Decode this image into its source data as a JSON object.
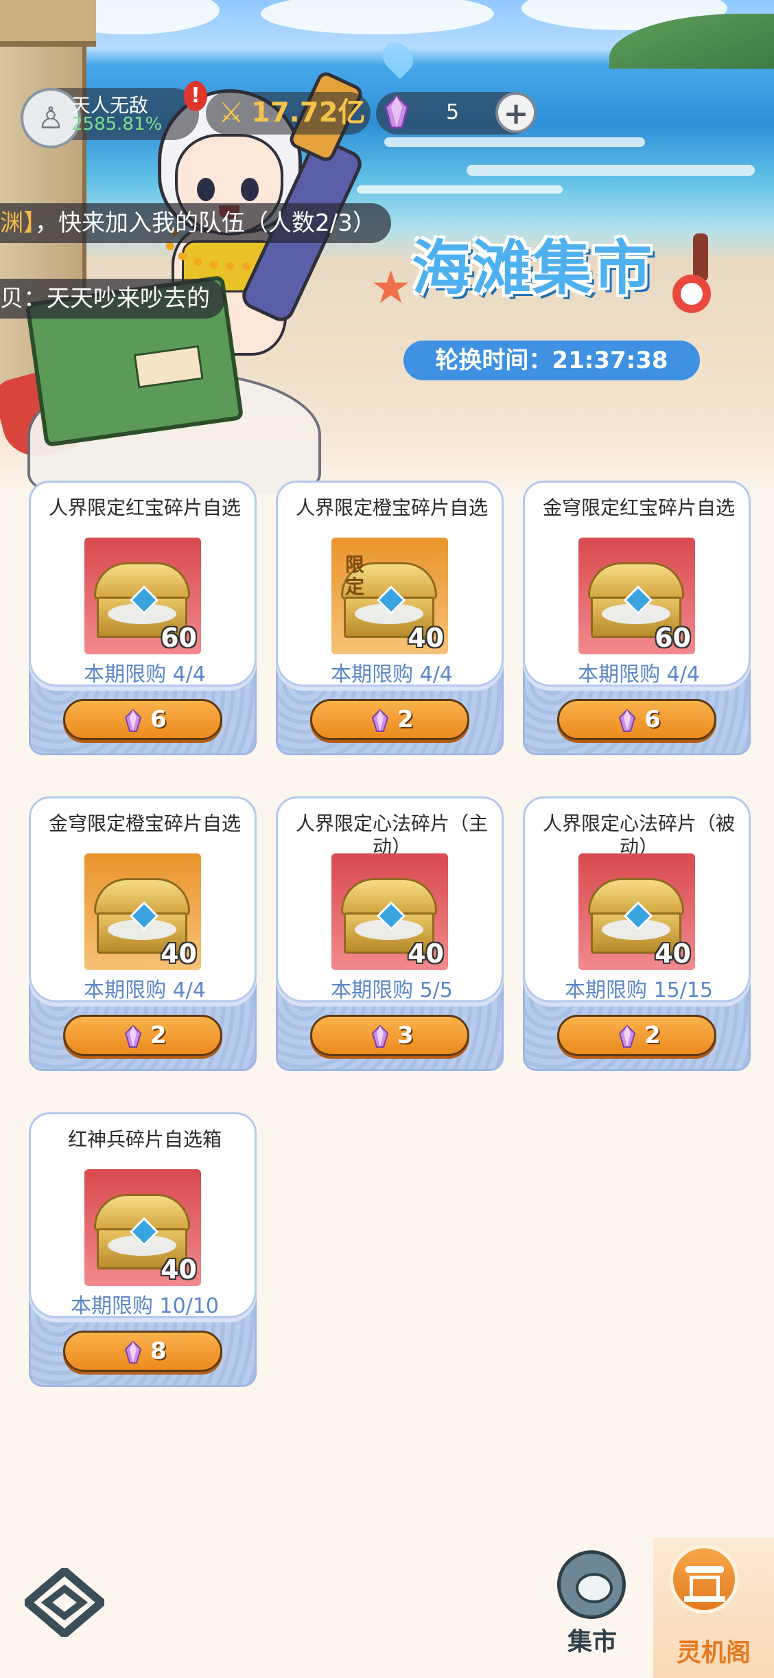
{
  "header": {
    "player_rank_name": "天人无敌",
    "player_rank_percent": "2585.81%",
    "alert_mark": "!",
    "power_value": "17.72亿",
    "gem_count": "5",
    "add_button": "+"
  },
  "chat": {
    "line1_highlight": "渊】",
    "line1_text": "，快来加入我的队伍（人数2/3）",
    "line2_text": "贝：天天吵来吵去的"
  },
  "market": {
    "title": "海滩集市",
    "rotation_time": "轮换时间：21:37:38"
  },
  "items": [
    {
      "name": "人界限定红宝碎片自选",
      "qty": "60",
      "limit": "本期限购 4/4",
      "price": "6",
      "bg": "red",
      "tag": ""
    },
    {
      "name": "人界限定橙宝碎片自选",
      "qty": "40",
      "limit": "本期限购 4/4",
      "price": "2",
      "bg": "orange",
      "tag": "限定"
    },
    {
      "name": "金穹限定红宝碎片自选",
      "qty": "60",
      "limit": "本期限购 4/4",
      "price": "6",
      "bg": "red",
      "tag": ""
    },
    {
      "name": "金穹限定橙宝碎片自选",
      "qty": "40",
      "limit": "本期限购 4/4",
      "price": "2",
      "bg": "orange",
      "tag": ""
    },
    {
      "name": "人界限定心法碎片（主动）",
      "qty": "40",
      "limit": "本期限购 5/5",
      "price": "3",
      "bg": "red",
      "tag": ""
    },
    {
      "name": "人界限定心法碎片（被动）",
      "qty": "40",
      "limit": "本期限购 15/15",
      "price": "2",
      "bg": "red",
      "tag": ""
    },
    {
      "name": "红神兵碎片自选箱",
      "qty": "40",
      "limit": "本期限购 10/10",
      "price": "8",
      "bg": "red",
      "tag": ""
    }
  ],
  "nav": {
    "market_label": "集市",
    "lingji_label": "灵机阁"
  },
  "colors": {
    "price_button": "#ec8a1f",
    "limit_text": "#5b86c9",
    "active_nav": "#e47a1f",
    "inactive_nav": "#3a4f5a"
  }
}
